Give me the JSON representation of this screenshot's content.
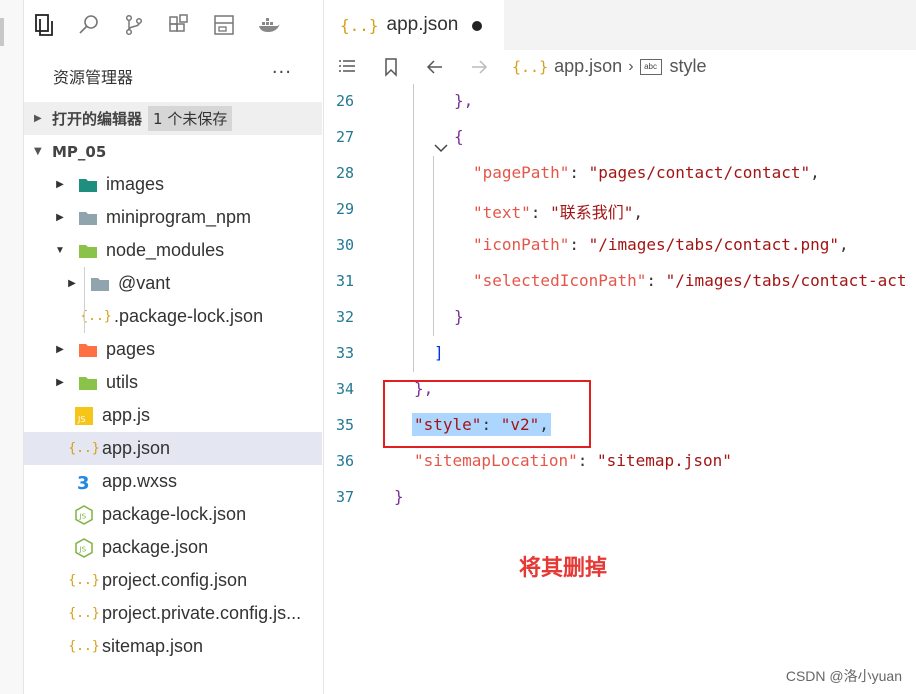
{
  "activity_bar": {
    "icons": [
      "explorer-icon",
      "search-icon",
      "source-control-icon",
      "extensions-icon",
      "outline-icon",
      "docker-icon"
    ]
  },
  "sidebar": {
    "title": "资源管理器",
    "more": "···",
    "open_editors": {
      "label": "打开的编辑器",
      "badge": "1 个未保存"
    },
    "project": {
      "label": "MP_05"
    },
    "items": [
      {
        "label": "images",
        "type": "folder",
        "color": "#1e8e7e"
      },
      {
        "label": "miniprogram_npm",
        "type": "folder",
        "color": "#90a4ae"
      },
      {
        "label": "node_modules",
        "type": "folder",
        "color": "#8bc34a"
      },
      {
        "label": "@vant",
        "type": "folder",
        "color": "#90a4ae"
      },
      {
        "label": ".package-lock.json",
        "type": "json"
      },
      {
        "label": "pages",
        "type": "folder",
        "color": "#ff7043"
      },
      {
        "label": "utils",
        "type": "folder",
        "color": "#8bc34a"
      },
      {
        "label": "app.js",
        "type": "js"
      },
      {
        "label": "app.json",
        "type": "json",
        "selected": true
      },
      {
        "label": "app.wxss",
        "type": "css"
      },
      {
        "label": "package-lock.json",
        "type": "node"
      },
      {
        "label": "package.json",
        "type": "node"
      },
      {
        "label": "project.config.json",
        "type": "json"
      },
      {
        "label": "project.private.config.js...",
        "type": "json"
      },
      {
        "label": "sitemap.json",
        "type": "json"
      }
    ]
  },
  "editor": {
    "tab": {
      "icon": "{..}",
      "label": "app.json"
    },
    "breadcrumb": {
      "file": "app.json",
      "symbol": "style",
      "symbol_icon": "abc"
    },
    "lines": [
      {
        "n": "26",
        "text": "},"
      },
      {
        "n": "27",
        "text": "{"
      },
      {
        "n": "28",
        "key": "\"pagePath\"",
        "value": "\"pages/contact/contact\""
      },
      {
        "n": "29",
        "key": "\"text\"",
        "value": "\"联系我们\""
      },
      {
        "n": "30",
        "key": "\"iconPath\"",
        "value": "\"/images/tabs/contact.png\""
      },
      {
        "n": "31",
        "key": "\"selectedIconPath\"",
        "value": "\"/images/tabs/contact-act"
      },
      {
        "n": "32",
        "text": "}"
      },
      {
        "n": "33",
        "text": "]"
      },
      {
        "n": "34",
        "text": "},"
      },
      {
        "n": "35",
        "key": "\"style\"",
        "value": "\"v2\""
      },
      {
        "n": "36",
        "key": "\"sitemapLocation\"",
        "value": "\"sitemap.json\""
      },
      {
        "n": "37",
        "text": "}"
      }
    ]
  },
  "annotation": "将其删掉",
  "watermark": "CSDN @洛小yuan"
}
